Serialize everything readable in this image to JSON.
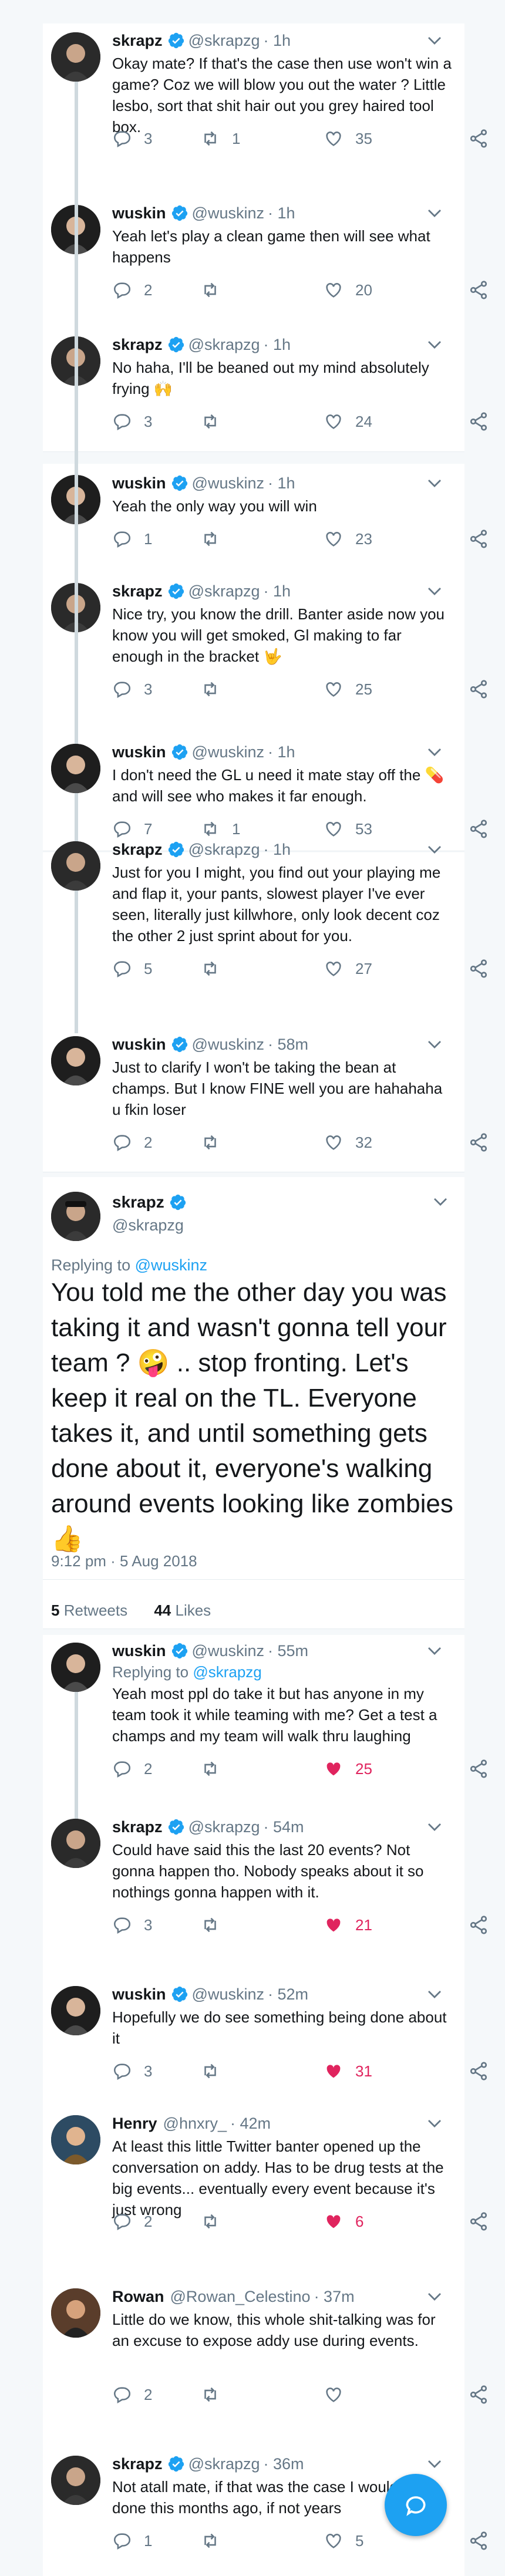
{
  "tweets": [
    {
      "name": "skrapz",
      "handle": "@skrapzg",
      "time": "· 1h",
      "text": "Okay mate? If that's the case then use won't win a game? Coz we will blow you out the water ? Little lesbo, sort that shit hair out you grey haired tool box.",
      "replies": "3",
      "retweets": "1",
      "likes": "35"
    },
    {
      "name": "wuskin",
      "handle": "@wuskinz",
      "time": "· 1h",
      "text": "Yeah let's play a clean game then will see what happens",
      "replies": "2",
      "retweets": "",
      "likes": "20"
    },
    {
      "name": "skrapz",
      "handle": "@skrapzg",
      "time": "· 1h",
      "text": "No haha, I'll be beaned out my mind absolutely frying 🙌",
      "replies": "3",
      "retweets": "",
      "likes": "24"
    },
    {
      "name": "wuskin",
      "handle": "@wuskinz",
      "time": "· 1h",
      "text": "Yeah the only way you will win",
      "replies": "1",
      "retweets": "",
      "likes": "23"
    },
    {
      "name": "skrapz",
      "handle": "@skrapzg",
      "time": "· 1h",
      "text": "Nice try, you know the drill. Banter aside now you know you will get smoked, Gl making to far enough in the bracket 🤟",
      "replies": "3",
      "retweets": "",
      "likes": "25"
    },
    {
      "name": "wuskin",
      "handle": "@wuskinz",
      "time": "· 1h",
      "text": "I don't need the GL u need it mate stay off the 💊 and will see who makes it far enough.",
      "replies": "7",
      "retweets": "1",
      "likes": "53"
    },
    {
      "name": "skrapz",
      "handle": "@skrapzg",
      "time": "· 1h",
      "text": "Just for you I might, you find out your playing me and flap it, your pants, slowest player I've ever seen, literally just killwhore, only look decent coz the other 2 just sprint about for you.",
      "replies": "5",
      "retweets": "",
      "likes": "27"
    },
    {
      "name": "wuskin",
      "handle": "@wuskinz",
      "time": "· 58m",
      "text": "Just to clarify I won't be taking the bean at champs. But I know FINE well you are hahahaha u fkin loser",
      "replies": "2",
      "retweets": "",
      "likes": "32"
    }
  ],
  "focused": {
    "name": "skrapz",
    "handle": "@skrapzg",
    "replying_prefix": "Replying to",
    "replying_to": "@wuskinz",
    "text": "You told me the other day you was taking it and wasn't gonna tell your team ? 🤪 .. stop fronting. Let's keep it real on the TL. Everyone takes it, and until something gets done about it, everyone's walking around events looking like zombies 👍",
    "meta": "9:12 pm · 5 Aug 2018",
    "retweets_count": "5",
    "retweets_label": "Retweets",
    "likes_count": "44",
    "likes_label": "Likes"
  },
  "replies": [
    {
      "name": "wuskin",
      "handle": "@wuskinz",
      "time": "· 55m",
      "replying_prefix": "Replying to",
      "replying_to": "@skrapzg",
      "text": "Yeah most ppl do take it but has anyone in my team took it while teaming with me? Get a test a champs and my team will walk thru laughing",
      "replies": "2",
      "retweets": "",
      "likes": "25",
      "liked": true
    },
    {
      "name": "skrapz",
      "handle": "@skrapzg",
      "time": "· 54m",
      "text": "Could have said this the last 20 events? Not gonna happen tho. Nobody speaks about it so nothings gonna happen with it.",
      "replies": "3",
      "retweets": "",
      "likes": "21",
      "liked": true
    },
    {
      "name": "wuskin",
      "handle": "@wuskinz",
      "time": "· 52m",
      "text": "Hopefully we do see something being done about it",
      "replies": "3",
      "retweets": "",
      "likes": "31",
      "liked": true
    },
    {
      "name": "Henry",
      "handle": "@hnxry_",
      "time": "· 42m",
      "text": "At least this little Twitter banter opened up the conversation on addy. Has to be drug tests at the big events... eventually every event because it's just wrong",
      "replies": "2",
      "retweets": "",
      "likes": "6",
      "liked": true
    },
    {
      "name": "Rowan",
      "handle": "@Rowan_Celestino",
      "time": "· 37m",
      "text": "Little do we know, this whole shit-talking was for an excuse to expose addy use during events.",
      "replies": "2",
      "retweets": "",
      "likes": "",
      "liked": false
    },
    {
      "name": "skrapz",
      "handle": "@skrapzg",
      "time": "· 36m",
      "text": "Not atall mate, if that was the case I would have done this months ago, if not years",
      "replies": "1",
      "retweets": "",
      "likes": "5",
      "liked": false
    }
  ],
  "colors": {
    "accent": "#1da1f2",
    "like": "#e0245e",
    "muted": "#657786"
  },
  "icons": [
    "reply-icon",
    "retweet-icon",
    "like-icon",
    "share-icon",
    "verified-icon",
    "chevron-down-icon",
    "compose-icon"
  ]
}
